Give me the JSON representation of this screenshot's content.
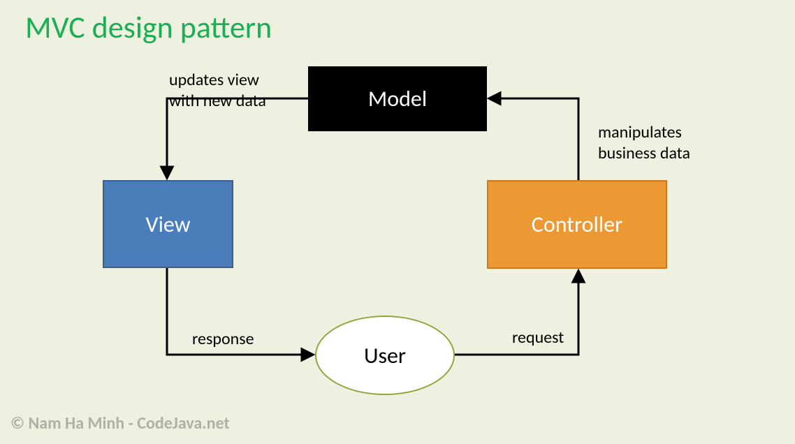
{
  "title": "MVC design pattern",
  "nodes": {
    "model": "Model",
    "view": "View",
    "controller": "Controller",
    "user": "User"
  },
  "edges": {
    "model_to_view": "updates view\nwith new data",
    "controller_to_model": "manipulates\nbusiness data",
    "view_to_user": "response",
    "user_to_controller": "request"
  },
  "footer": "© Nam Ha Minh - CodeJava.net"
}
